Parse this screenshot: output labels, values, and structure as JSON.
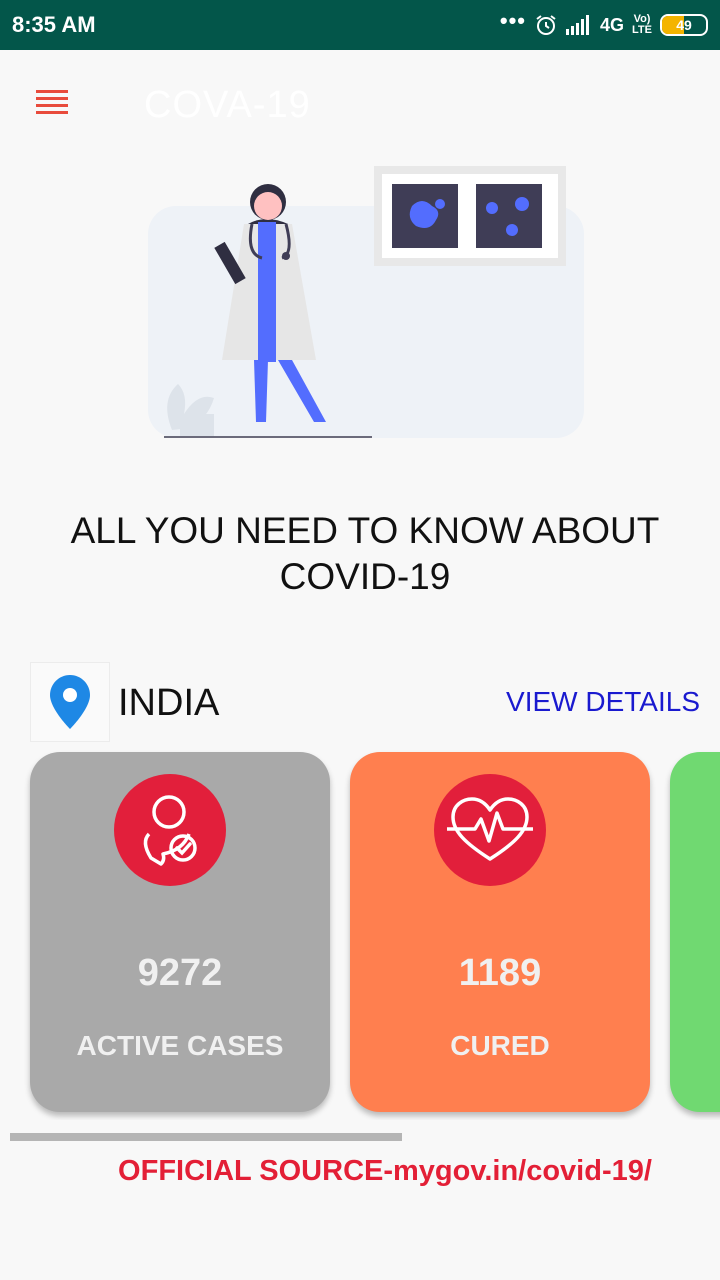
{
  "status_bar": {
    "time": "8:35 AM",
    "dots": "•••",
    "network": "4G",
    "volte": "Vo)\nLTE",
    "battery": "49",
    "battery_level": 0.49
  },
  "header": {
    "title": "COVA-19"
  },
  "headline": "ALL YOU NEED TO KNOW ABOUT COVID-19",
  "location": {
    "country": "INDIA",
    "view_details_label": "VIEW DETAILS"
  },
  "cards": [
    {
      "value": "9272",
      "label": "ACTIVE CASES",
      "color": "#a9a9a9"
    },
    {
      "value": "1189",
      "label": "CURED",
      "color": "#ff7f4f"
    },
    {
      "value": "",
      "label": "",
      "color": "#70d971"
    }
  ],
  "footer": {
    "source": "OFFICIAL SOURCE-mygov.in/covid-19/"
  },
  "colors": {
    "status_bar": "#03564a",
    "icon_circle": "#e21f3b",
    "menu": "#e84b3c",
    "link": "#1a1acf",
    "source": "#e31f36"
  }
}
